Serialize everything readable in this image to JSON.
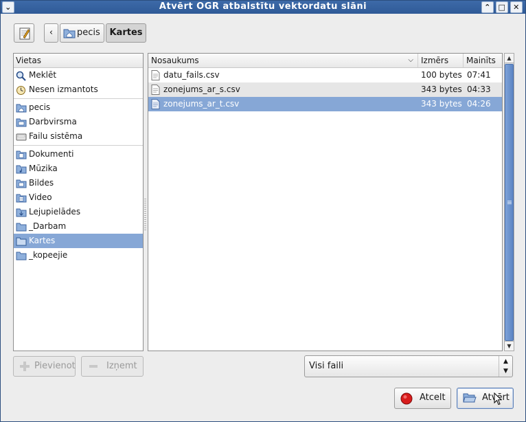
{
  "window": {
    "title": "Atvērt OGR atbalstītu vektordatu slāni"
  },
  "pathbar": {
    "crumbs": [
      "pecis",
      "Kartes"
    ]
  },
  "places": {
    "header": "Vietas",
    "groups": [
      [
        "Meklēt",
        "Nesen izmantots"
      ],
      [
        "pecis",
        "Darbvirsma",
        "Failu sistēma"
      ],
      [
        "Dokumenti",
        "Mūzika",
        "Bildes",
        "Video",
        "Lejupielādes",
        "_Darbam",
        "Kartes",
        "_kopeejie"
      ]
    ],
    "selected": "Kartes"
  },
  "files": {
    "columns": {
      "name": "Nosaukums",
      "size": "Izmērs",
      "modified": "Mainīts"
    },
    "rows": [
      {
        "name": "datu_fails.csv",
        "size": "100 bytes",
        "modified": "07:41"
      },
      {
        "name": "zonejums_ar_s.csv",
        "size": "343 bytes",
        "modified": "04:33"
      },
      {
        "name": "zonejums_ar_t.csv",
        "size": "343 bytes",
        "modified": "04:26"
      }
    ],
    "selected_index": 2
  },
  "buttons": {
    "add": "Pievienot",
    "remove": "Izņemt",
    "cancel": "Atcelt",
    "open": "Atvērt"
  },
  "filter": {
    "selected": "Visi faili"
  },
  "colors": {
    "selection": "#86a7d6",
    "titlebar": "#3d6aa8"
  }
}
